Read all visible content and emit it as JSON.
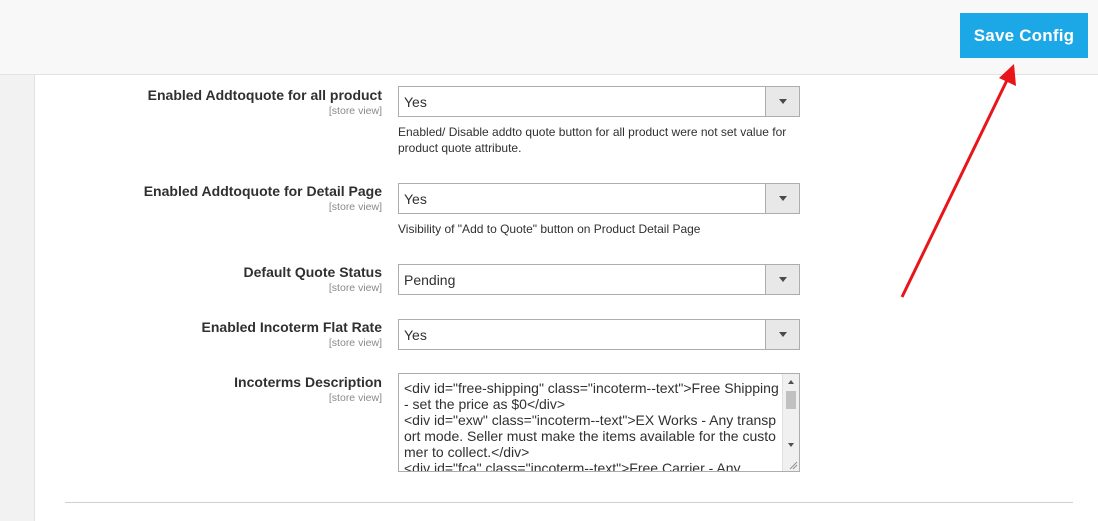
{
  "header": {
    "save_label": "Save Config"
  },
  "fields": {
    "all_product": {
      "label": "Enabled Addtoquote for all product",
      "scope": "[store view]",
      "value": "Yes",
      "note": "Enabled/ Disable addto quote button for all product were not set value for product quote attribute."
    },
    "detail_page": {
      "label": "Enabled Addtoquote for Detail Page",
      "scope": "[store view]",
      "value": "Yes",
      "note": "Visibility of \"Add to Quote\" button on Product Detail Page"
    },
    "quote_status": {
      "label": "Default Quote Status",
      "scope": "[store view]",
      "value": "Pending"
    },
    "incoterm_flat_rate": {
      "label": "Enabled Incoterm Flat Rate",
      "scope": "[store view]",
      "value": "Yes"
    },
    "incoterms_description": {
      "label": "Incoterms Description",
      "scope": "[store view]",
      "value": "<div id=\"free-shipping\" class=\"incoterm--text\">Free Shipping - set the price as $0</div>\n<div id=\"exw\" class=\"incoterm--text\">EX Works - Any transport mode. Seller must make the items available for the customer to collect.</div>\n<div id=\"fca\" class=\"incoterm--text\">Free Carrier - Any"
    }
  },
  "annotation": {
    "arrow_color": "#e8151b"
  },
  "colors": {
    "accent": "#1ca7e6"
  }
}
